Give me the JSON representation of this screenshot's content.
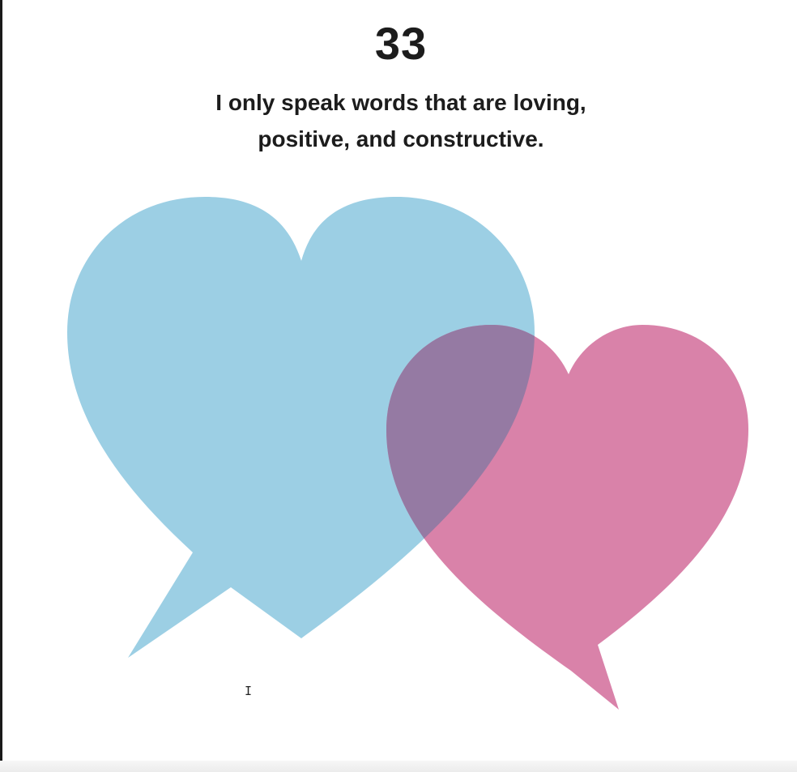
{
  "page": {
    "number": "33",
    "affirmation_line1": "I only speak words that are loving,",
    "affirmation_line2": "positive, and constructive."
  },
  "illustration": {
    "left_heart_color": "#9acee3",
    "right_heart_color": "#d982a9",
    "overlap_color": "#957aa3",
    "left_heart_icon": "speech-bubble-heart-icon",
    "right_heart_icon": "speech-bubble-heart-icon"
  },
  "cursor": {
    "icon": "i-beam-cursor-icon",
    "glyph": "I"
  }
}
